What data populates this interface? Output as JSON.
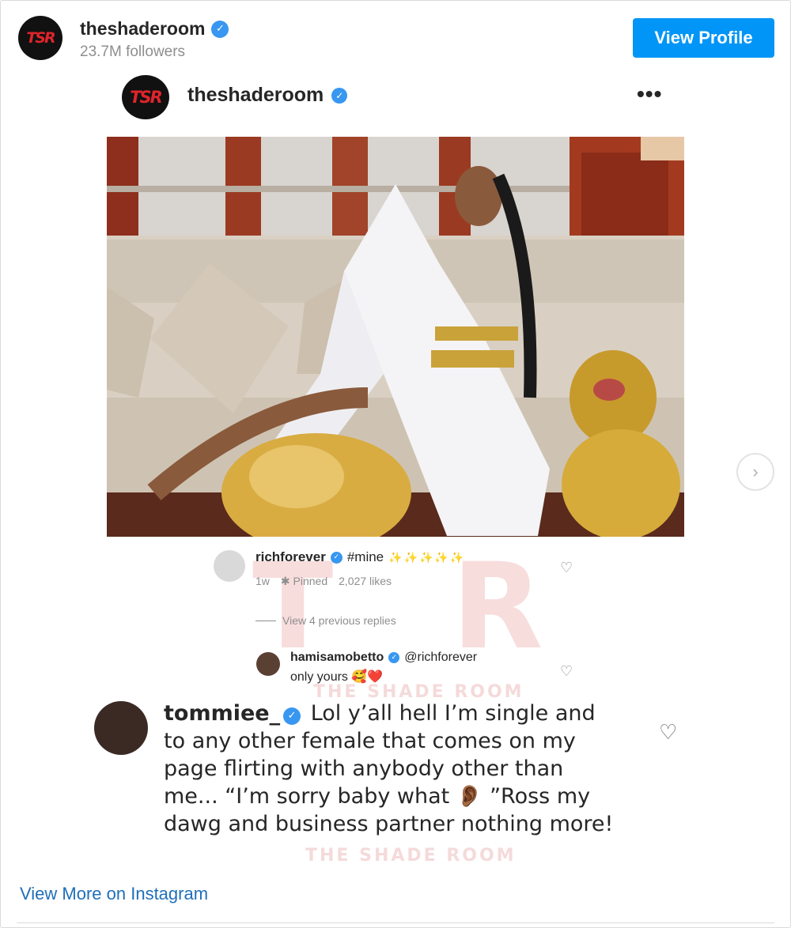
{
  "header": {
    "logo_text": "TSR",
    "username": "theshaderoom",
    "followers": "23.7M followers",
    "view_profile_label": "View Profile"
  },
  "post": {
    "username": "theshaderoom",
    "more_icon": "•••"
  },
  "watermark": {
    "letter1": "T",
    "letter2": "R",
    "text": "THE SHADE ROOM"
  },
  "comments": [
    {
      "username": "richforever",
      "text": "#mine",
      "emoji": "✨✨✨✨✨",
      "age": "1w",
      "pinned": "Pinned",
      "likes": "2,027 likes",
      "view_replies": "View 4 previous replies"
    },
    {
      "username": "hamisamobetto",
      "mention": "@richforever",
      "text": "only yours",
      "emoji": "🥰❤️"
    },
    {
      "username": "tommiee_",
      "text_part1": "Lol y’all hell I’m single and to any other female that comes on my page flirting with anybody other than me... “I’m sorry baby what",
      "emoji": "👂🏾",
      "text_part2": "”Ross my dawg and business partner nothing more!"
    }
  ],
  "footer": {
    "view_more_label": "View More on Instagram"
  },
  "colors": {
    "accent": "#0095f6",
    "verified": "#3897f0",
    "link": "#1f6fb8",
    "muted": "#8e8e8e"
  }
}
